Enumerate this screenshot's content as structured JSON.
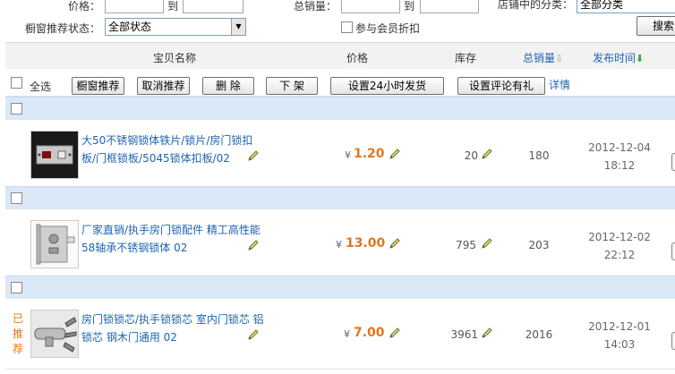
{
  "filters": {
    "price_label": "价格：",
    "to1": "到",
    "sales_label": "总销量：",
    "to2": "到",
    "category_label": "店铺中的分类：",
    "category_value": "全部分类",
    "window_label": "橱窗推荐状态：",
    "window_value": "全部状态",
    "member_discount_label": "参与会员折扣",
    "search_label": "搜索"
  },
  "columns": {
    "name": "宝贝名称",
    "price": "价格",
    "stock": "库存",
    "sales": "总销量",
    "published": "发布时间"
  },
  "toolbar": {
    "select_all": "全选",
    "recommend": "橱窗推荐",
    "cancel_recommend": "取消推荐",
    "delete": "删 除",
    "delist": "下 架",
    "ship24": "设置24小时发货",
    "review_gift": "设置评论有礼",
    "details": "详情"
  },
  "items": [
    {
      "title_line1": "大50不锈钢锁体铁片/锁片/房门锁扣",
      "title_line2": "板/门框锁板/5045锁体扣板/02",
      "currency": "¥",
      "price": "1.20",
      "stock": "20",
      "sales": "180",
      "date": "2012-12-04",
      "time": "18:12",
      "status_line1": "",
      "status_line2": ""
    },
    {
      "title_line1": "厂家直销/执手房门锁配件 精工高性能",
      "title_line2": "58轴承不锈钢锁体 02",
      "currency": "¥",
      "price": "13.00",
      "stock": "795",
      "sales": "203",
      "date": "2012-12-02",
      "time": "22:12",
      "status_line1": "",
      "status_line2": ""
    },
    {
      "title_line1": "房门锁锁芯/执手锁锁芯 室内门锁芯 铝",
      "title_line2": "锁芯 钢木门通用 02",
      "currency": "¥",
      "price": "7.00",
      "stock": "3961",
      "sales": "2016",
      "date": "2012-12-01",
      "time": "14:03",
      "status_line1": "已",
      "status_line2": "推荐"
    }
  ],
  "colors": {
    "accent_blue": "#1d64b0",
    "price_orange": "#e4761a",
    "row_separator": "#dbe8f7",
    "sort_arrow_green": "#3aa541"
  }
}
